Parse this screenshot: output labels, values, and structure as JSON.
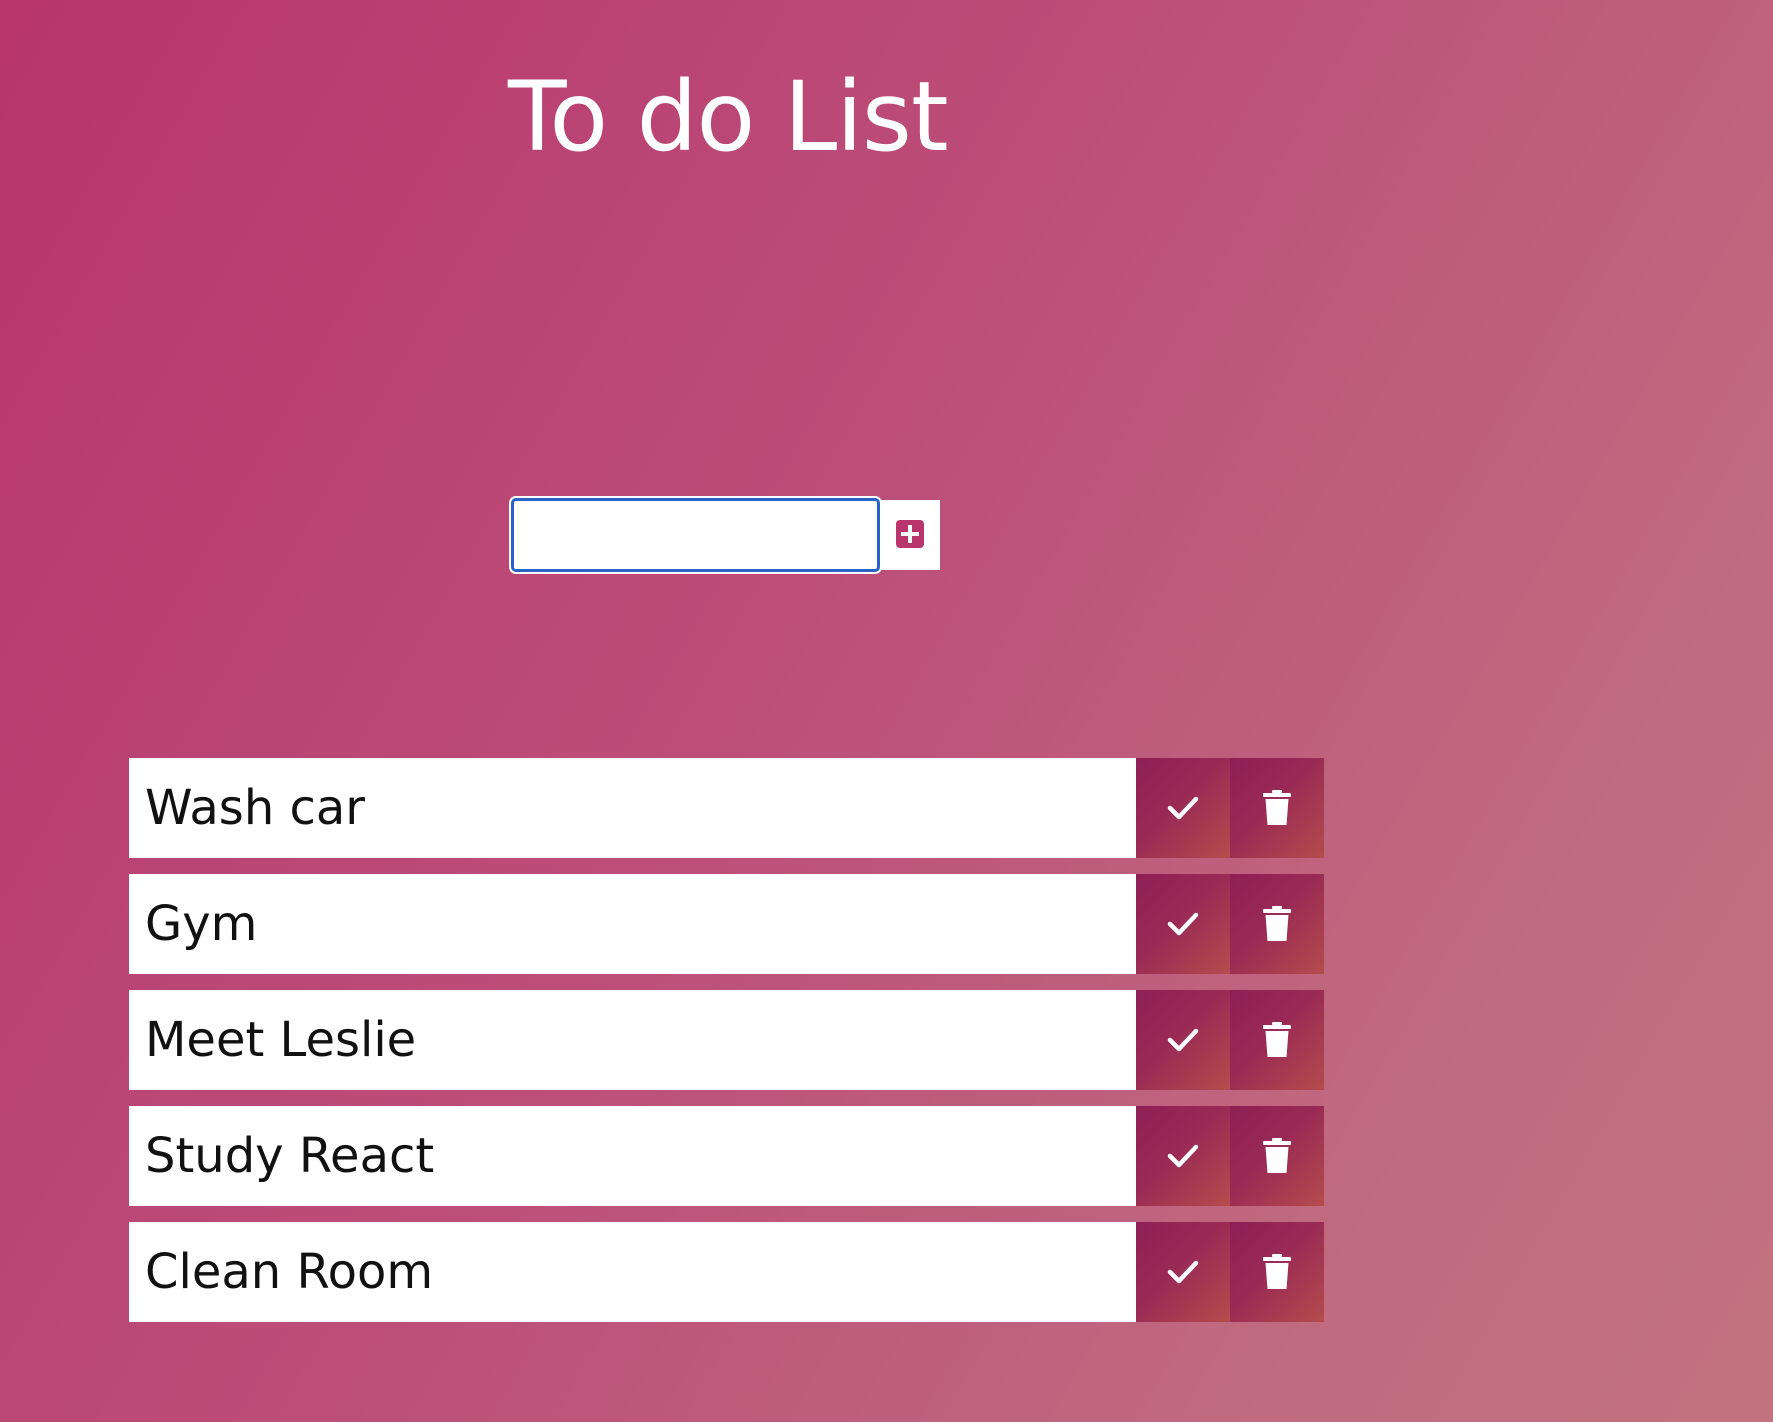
{
  "header": {
    "title": "To do List"
  },
  "add_form": {
    "input_value": "",
    "placeholder": "",
    "add_icon": "plus-square-icon"
  },
  "todos": [
    {
      "text": "Wash car",
      "complete_icon": "check-icon",
      "delete_icon": "trash-icon"
    },
    {
      "text": "Gym",
      "complete_icon": "check-icon",
      "delete_icon": "trash-icon"
    },
    {
      "text": "Meet Leslie",
      "complete_icon": "check-icon",
      "delete_icon": "trash-icon"
    },
    {
      "text": "Study React",
      "complete_icon": "check-icon",
      "delete_icon": "trash-icon"
    },
    {
      "text": "Clean Room",
      "complete_icon": "check-icon",
      "delete_icon": "trash-icon"
    }
  ],
  "colors": {
    "accent": "#b8356d",
    "button_gradient_start": "#8e1f55",
    "button_gradient_end": "#b54c4c",
    "input_focus_border": "#2a63c8"
  }
}
